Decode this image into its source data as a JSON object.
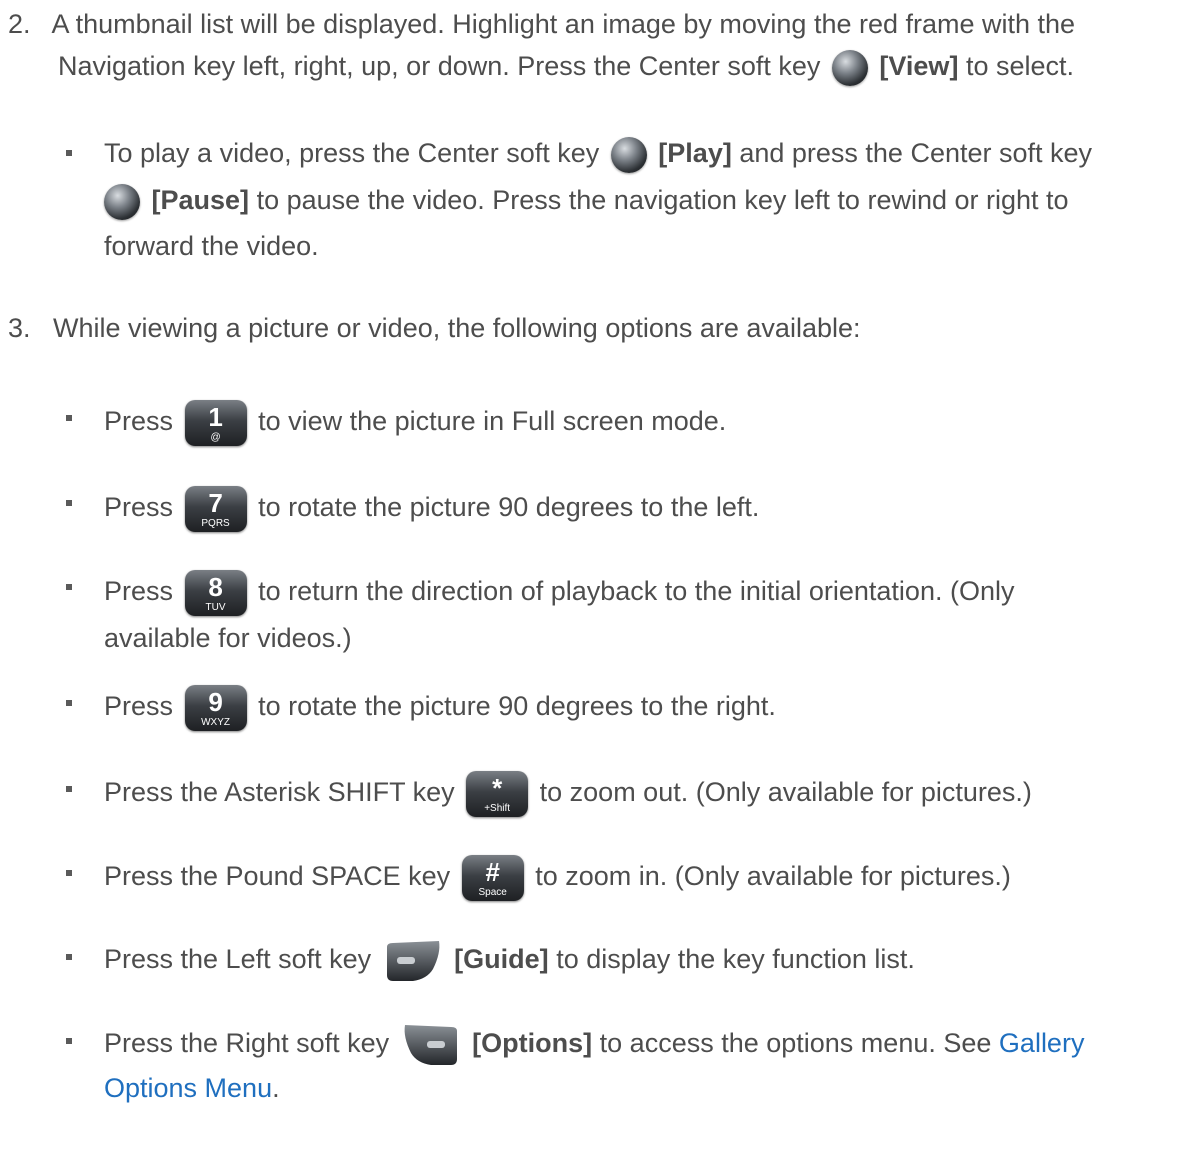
{
  "step2": {
    "number": "2.",
    "line1": "A thumbnail list will be displayed. Highlight an image by moving the red frame with the",
    "line2_a": "Navigation key left, right, up, or down. Press the Center soft key",
    "line2_key": "[View]",
    "line2_b": "to select."
  },
  "video_bullet": {
    "a": "To play a video, press the Center soft key",
    "key1": "[Play]",
    "b": "and press the Center soft key",
    "key2": "[Pause]",
    "c": "to pause the video. Press the navigation key left to rewind or right to",
    "d": "forward the video."
  },
  "step3": {
    "number": "3.",
    "text": "While viewing a picture or video, the following options are available:"
  },
  "options": {
    "press": "Press",
    "key1": {
      "main": "1",
      "sub": "@",
      "after": "to view the picture in Full screen mode."
    },
    "key7": {
      "main": "7",
      "sub": "PQRS",
      "after": "to rotate the picture 90 degrees to the left."
    },
    "key8": {
      "main": "8",
      "sub": "TUV",
      "after": "to return the direction of playback to the initial orientation. (Only",
      "after2": "available for videos.)"
    },
    "key9": {
      "main": "9",
      "sub": "WXYZ",
      "after": "to rotate the picture 90 degrees to the right."
    },
    "asterisk": {
      "before": "Press the Asterisk SHIFT key",
      "main": "*",
      "sub": "+Shift",
      "after": "to zoom out. (Only available for pictures.)"
    },
    "pound": {
      "before": "Press the Pound SPACE key",
      "main": "#",
      "sub": "Space",
      "after": "to zoom in. (Only available for pictures.)"
    },
    "left_soft": {
      "before": "Press the Left soft key",
      "key": "[Guide]",
      "after": "to display the key function list."
    },
    "right_soft": {
      "before": "Press the Right soft key",
      "key": "[Options]",
      "after": "to access the options menu. See",
      "link1": "Gallery",
      "link2": "Options Menu",
      "period": "."
    }
  }
}
